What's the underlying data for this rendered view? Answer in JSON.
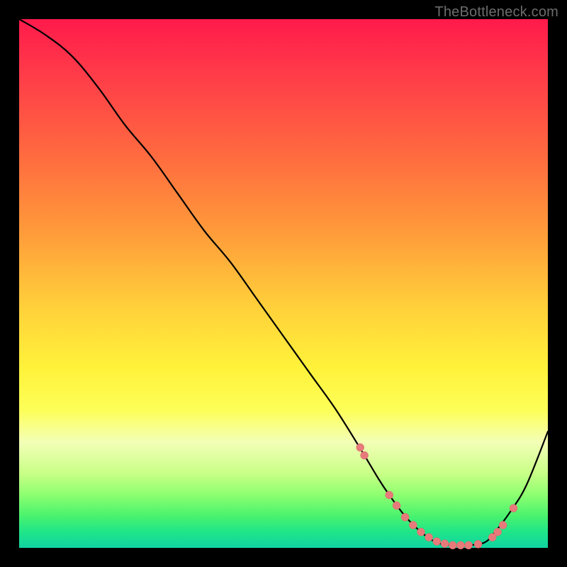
{
  "attribution": "TheBottleneck.com",
  "colors": {
    "background": "#000000",
    "gradient_top": "#ff1a4b",
    "gradient_bottom": "#12d2a2",
    "curve_stroke": "#000000",
    "dot_fill": "#e77a7a"
  },
  "chart_data": {
    "type": "line",
    "title": "",
    "xlabel": "",
    "ylabel": "",
    "xlim": [
      0,
      100
    ],
    "ylim": [
      0,
      100
    ],
    "note": "Axis values are normalized percentages inferred from the plot-area pixel coordinates; the y-axis here represents the visible curve height where 0 is the bottom (green) and 100 is the top (red).",
    "series": [
      {
        "name": "curve",
        "x": [
          0,
          5,
          10,
          15,
          20,
          25,
          30,
          35,
          40,
          45,
          50,
          55,
          60,
          65,
          68,
          70,
          73,
          76,
          79,
          82,
          85,
          88,
          90,
          93,
          96,
          100
        ],
        "y": [
          100,
          97,
          93,
          87,
          80,
          74,
          67,
          60,
          54,
          47,
          40,
          33,
          26,
          18,
          13,
          10,
          6,
          3,
          1,
          0.5,
          0.5,
          1,
          3,
          7,
          12,
          22
        ]
      }
    ],
    "markers": {
      "name": "highlighted-points",
      "x": [
        64.5,
        65.3,
        70.0,
        71.4,
        73.0,
        74.5,
        76.0,
        77.5,
        79.0,
        80.5,
        82.0,
        83.5,
        85.0,
        86.8,
        89.5,
        90.5,
        91.5,
        93.5
      ],
      "y": [
        19.0,
        17.5,
        10.0,
        8.0,
        5.8,
        4.3,
        3.0,
        2.0,
        1.2,
        0.8,
        0.5,
        0.5,
        0.5,
        0.7,
        2.0,
        3.0,
        4.3,
        7.5
      ]
    }
  }
}
